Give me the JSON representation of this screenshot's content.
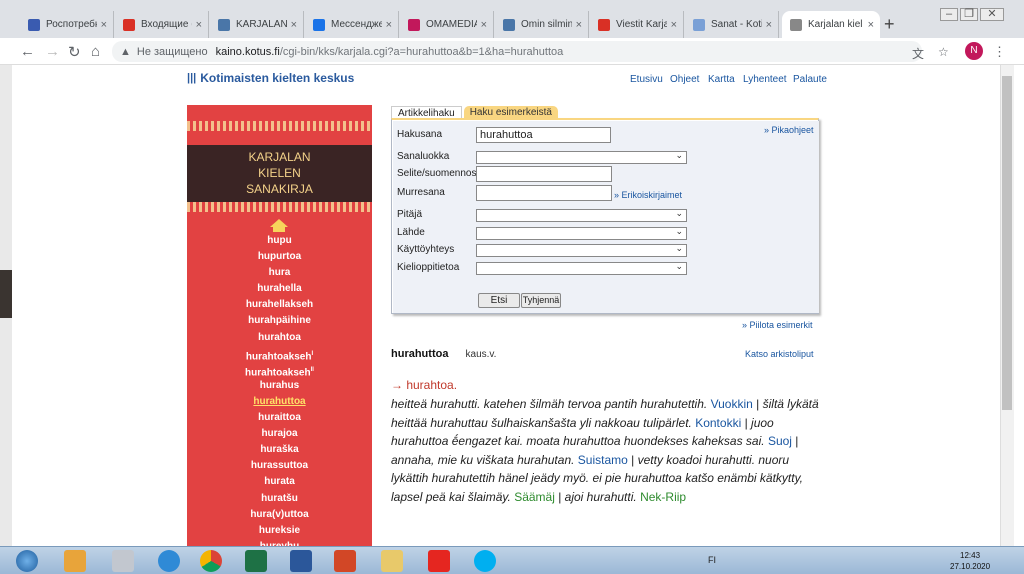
{
  "browser": {
    "tabs": [
      {
        "title": "Роспотребн",
        "color": "#3a5bb0"
      },
      {
        "title": "Входящие (1",
        "color": "#d93025"
      },
      {
        "title": "KARJALAN K",
        "color": "#4a76a8"
      },
      {
        "title": "Мессендже",
        "color": "#1a73e8"
      },
      {
        "title": "OMAMEDIA",
        "color": "#c2185b"
      },
      {
        "title": "Omin silmin",
        "color": "#4a76a8"
      },
      {
        "title": "Viestit Karja",
        "color": "#d93025"
      },
      {
        "title": "Sanat - Kotir",
        "color": "#7aa0d6"
      },
      {
        "title": "Karjalan kiel",
        "color": "#888888"
      }
    ],
    "new_tab": "+",
    "url_security": "Не защищено",
    "url_host": "kaino.kotus.fi",
    "url_path": "/cgi-bin/kks/karjala.cgi?a=hurahuttoa&b=1&ha=hurahuttoa",
    "avatar_letter": "N"
  },
  "site": {
    "logo": "Kotimaisten kielten keskus",
    "toplinks": [
      "Etusivu",
      "Ohjeet",
      "Kartta",
      "Lyhenteet",
      "Palaute"
    ]
  },
  "sidebar": {
    "title_lines": [
      "KARJALAN",
      "KIELEN",
      "SANAKIRJA"
    ],
    "items": [
      {
        "label": "hupu"
      },
      {
        "label": "hupurtoa"
      },
      {
        "label": "hura"
      },
      {
        "label": "hurahella"
      },
      {
        "label": "hurahellakseh"
      },
      {
        "label": "hurahpäihine"
      },
      {
        "label": "hurahtoa"
      },
      {
        "label": "hurahtoakseh",
        "sup": "I"
      },
      {
        "label": "hurahtoakseh",
        "sup": "II"
      },
      {
        "label": "hurahus"
      },
      {
        "label": "hurahuttoa",
        "current": true
      },
      {
        "label": "huraittoa"
      },
      {
        "label": "hurajoa"
      },
      {
        "label": "huraška"
      },
      {
        "label": "hurassuttoa"
      },
      {
        "label": "hurata"
      },
      {
        "label": "huratšu"
      },
      {
        "label": "hura(v)uttoa"
      },
      {
        "label": "hureksie"
      },
      {
        "label": "hureyhu"
      }
    ]
  },
  "search": {
    "tab_active": "Artikkelihaku",
    "tab_other": "Haku esimerkeistä",
    "pikaohjeet": "» Pikaohjeet",
    "fields": [
      {
        "label": "Hakusana",
        "value": "hurahuttoa",
        "kind": "text"
      },
      {
        "label": "Sanaluokka",
        "value": "",
        "kind": "select"
      },
      {
        "label": "Selite/suomennos",
        "value": "",
        "kind": "text"
      },
      {
        "label": "Murresana",
        "value": "",
        "kind": "text"
      },
      {
        "label": "Pitäjä",
        "value": "",
        "kind": "select"
      },
      {
        "label": "Lähde",
        "value": "",
        "kind": "select"
      },
      {
        "label": "Käyttöyhteys",
        "value": "",
        "kind": "select"
      },
      {
        "label": "Kielioppitietoa",
        "value": "",
        "kind": "select"
      }
    ],
    "erikois_link": "» Erikoiskirjaimet",
    "etsi": "Etsi",
    "tyhjenna": "Tyhjennä",
    "piilota": "» Piilota esimerkit"
  },
  "entry": {
    "headword": "hurahuttoa",
    "pos": "kaus.v.",
    "katso": "Katso arkistoliput",
    "reference": "→ hurahtoa.",
    "examples": [
      {
        "text": "heitteä hurahutti. katehen šilmäh tervoa pantih hurahutettih.",
        "place": "Vuokkin"
      },
      {
        "text": "šiltä lykätä heittää hurahuttau šulhaiskanšašta yli nakkoau tulipärlet.",
        "place": "Kontokki"
      },
      {
        "text": "juoo hurahuttoa ḗengazet kai. moata hurahuttoa huondekses kaheksas sai.",
        "place": "Suoj"
      },
      {
        "text": "annaha, mie ku viškata hurahutan.",
        "place": "Suistamo"
      },
      {
        "text": "vetty koadoi hurahutti. nuoru lykättih hurahutettih hänel jeädy myö. ei pie hurahuttoa katšo enämbi kätkytty, lapsel peä kai šlaimäy.",
        "place": "Säämäj",
        "green": true
      },
      {
        "text": "ajoi hurahutti.",
        "place": "Nek-Riip",
        "green": true
      }
    ]
  },
  "taskbar": {
    "lang": "FI",
    "time": "12:43",
    "date": "27.10.2020"
  }
}
